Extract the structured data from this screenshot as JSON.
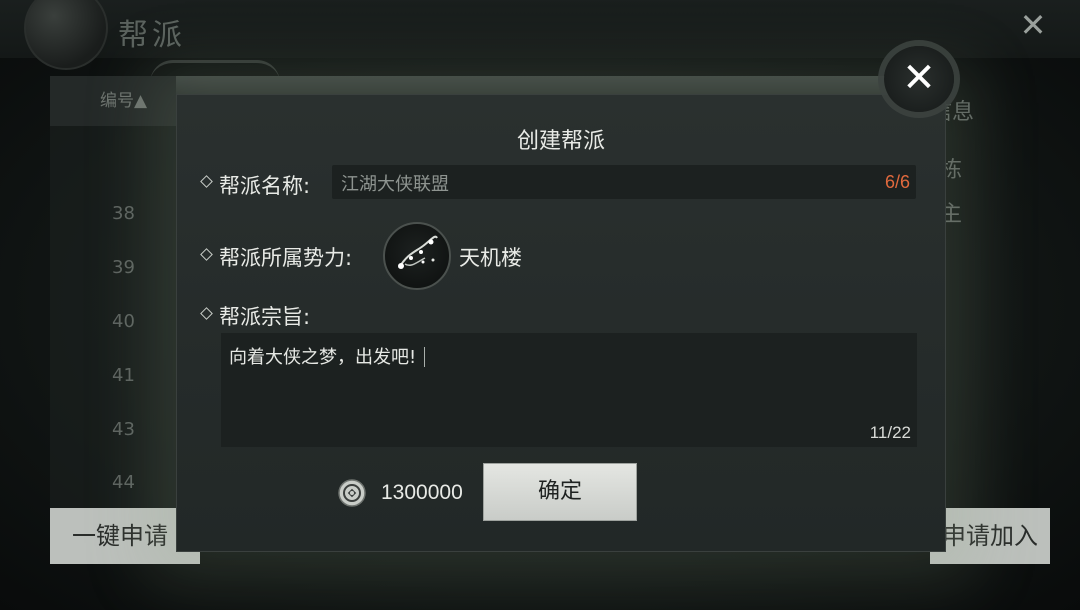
{
  "background": {
    "title": "帮派",
    "column_header": "编号▲",
    "row_numbers": [
      "38",
      "39",
      "40",
      "41",
      "43",
      "44"
    ],
    "right_panel_texts": [
      "信息",
      "栋",
      "主"
    ],
    "left_button": "一键申请",
    "right_button": "申请加入"
  },
  "modal": {
    "title": "创建帮派",
    "name_label": "帮派名称:",
    "name_value": "江湖大侠联盟",
    "name_count": "6/6",
    "faction_label": "帮派所属势力:",
    "faction_name": "天机楼",
    "faction_icon": "constellation-icon",
    "purpose_label": "帮派宗旨:",
    "purpose_value": "向着大侠之梦，出发吧!",
    "purpose_count": "11/22",
    "cost_icon": "coin-icon",
    "cost": "1300000",
    "confirm": "确定",
    "close_icon": "close-icon"
  },
  "colors": {
    "count_accent": "#e0693d",
    "button_bg": "#d8dbd7",
    "panel_bg": "#272d2c"
  }
}
